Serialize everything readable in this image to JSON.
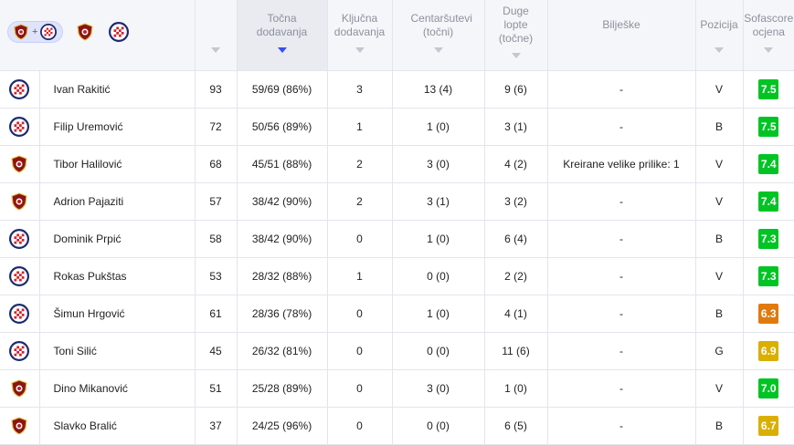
{
  "header": {
    "filter_plus": "+",
    "columns": {
      "points": "",
      "accurate_passes": "Točna dodavanja",
      "key_passes": "Ključna dodavanja",
      "crosses": "Centaršutevi (točni)",
      "long_balls": "Duge lopte (točne)",
      "notes": "Bilješke",
      "position": "Pozicija",
      "rating": "Sofascore ocjena"
    }
  },
  "colors": {
    "accent": "#374df5",
    "rating_green": "#00c424",
    "rating_orange": "#e07a0e",
    "rating_yellow": "#d9af00"
  },
  "players": [
    {
      "team_icon": "hajduk-crest-icon",
      "name": "Ivan Rakitić",
      "points": "93",
      "accurate_passes": "59/69 (86%)",
      "key_passes": "3",
      "crosses": "13 (4)",
      "long_balls": "9 (6)",
      "notes": "-",
      "position": "V",
      "rating": "7.5",
      "rating_color": "#00c424"
    },
    {
      "team_icon": "hajduk-crest-icon",
      "name": "Filip Uremović",
      "points": "72",
      "accurate_passes": "50/56 (89%)",
      "key_passes": "1",
      "crosses": "1 (0)",
      "long_balls": "3 (1)",
      "notes": "-",
      "position": "B",
      "rating": "7.5",
      "rating_color": "#00c424"
    },
    {
      "team_icon": "opponent-crest-icon",
      "name": "Tibor Halilović",
      "points": "68",
      "accurate_passes": "45/51 (88%)",
      "key_passes": "2",
      "crosses": "3 (0)",
      "long_balls": "4 (2)",
      "notes": "Kreirane velike prilike: 1",
      "position": "V",
      "rating": "7.4",
      "rating_color": "#00c424"
    },
    {
      "team_icon": "opponent-crest-icon",
      "name": "Adrion Pajaziti",
      "points": "57",
      "accurate_passes": "38/42 (90%)",
      "key_passes": "2",
      "crosses": "3 (1)",
      "long_balls": "3 (2)",
      "notes": "-",
      "position": "V",
      "rating": "7.4",
      "rating_color": "#00c424"
    },
    {
      "team_icon": "hajduk-crest-icon",
      "name": "Dominik Prpić",
      "points": "58",
      "accurate_passes": "38/42 (90%)",
      "key_passes": "0",
      "crosses": "1 (0)",
      "long_balls": "6 (4)",
      "notes": "-",
      "position": "B",
      "rating": "7.3",
      "rating_color": "#00c424"
    },
    {
      "team_icon": "hajduk-crest-icon",
      "name": "Rokas Pukštas",
      "points": "53",
      "accurate_passes": "28/32 (88%)",
      "key_passes": "1",
      "crosses": "0 (0)",
      "long_balls": "2 (2)",
      "notes": "-",
      "position": "V",
      "rating": "7.3",
      "rating_color": "#00c424"
    },
    {
      "team_icon": "hajduk-crest-icon",
      "name": "Šimun Hrgović",
      "points": "61",
      "accurate_passes": "28/36 (78%)",
      "key_passes": "0",
      "crosses": "1 (0)",
      "long_balls": "4 (1)",
      "notes": "-",
      "position": "B",
      "rating": "6.3",
      "rating_color": "#e07a0e"
    },
    {
      "team_icon": "hajduk-crest-icon",
      "name": "Toni Silić",
      "points": "45",
      "accurate_passes": "26/32 (81%)",
      "key_passes": "0",
      "crosses": "0 (0)",
      "long_balls": "11 (6)",
      "notes": "-",
      "position": "G",
      "rating": "6.9",
      "rating_color": "#d9af00"
    },
    {
      "team_icon": "opponent-crest-icon",
      "name": "Dino Mikanović",
      "points": "51",
      "accurate_passes": "25/28 (89%)",
      "key_passes": "0",
      "crosses": "3 (0)",
      "long_balls": "1 (0)",
      "notes": "-",
      "position": "V",
      "rating": "7.0",
      "rating_color": "#00c424"
    },
    {
      "team_icon": "opponent-crest-icon",
      "name": "Slavko Bralić",
      "points": "37",
      "accurate_passes": "24/25 (96%)",
      "key_passes": "0",
      "crosses": "0 (0)",
      "long_balls": "6 (5)",
      "notes": "-",
      "position": "B",
      "rating": "6.7",
      "rating_color": "#d9af00"
    }
  ]
}
